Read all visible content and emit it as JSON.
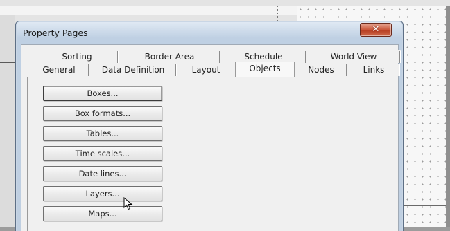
{
  "dialog": {
    "title": "Property Pages",
    "close_symbol": "✕"
  },
  "tabs": {
    "back_row": [
      {
        "label": "Sorting"
      },
      {
        "label": "Border Area"
      },
      {
        "label": "Schedule"
      },
      {
        "label": "World View"
      }
    ],
    "front_row": [
      {
        "label": "General"
      },
      {
        "label": "Data Definition"
      },
      {
        "label": "Layout"
      },
      {
        "label": "Objects",
        "active": true
      },
      {
        "label": "Nodes"
      },
      {
        "label": "Links"
      }
    ]
  },
  "objects_panel": {
    "buttons": [
      {
        "label": "Boxes..."
      },
      {
        "label": "Box formats..."
      },
      {
        "label": "Tables..."
      },
      {
        "label": "Time scales..."
      },
      {
        "label": "Date lines..."
      },
      {
        "label": "Layers..."
      },
      {
        "label": "Maps..."
      }
    ]
  },
  "icons": {
    "close": "close-icon",
    "cursor": "arrow-cursor-icon"
  },
  "colors": {
    "close_button": "#c9563a",
    "title_bar": "#bfd0e3",
    "panel_bg": "#f0f0f0"
  }
}
